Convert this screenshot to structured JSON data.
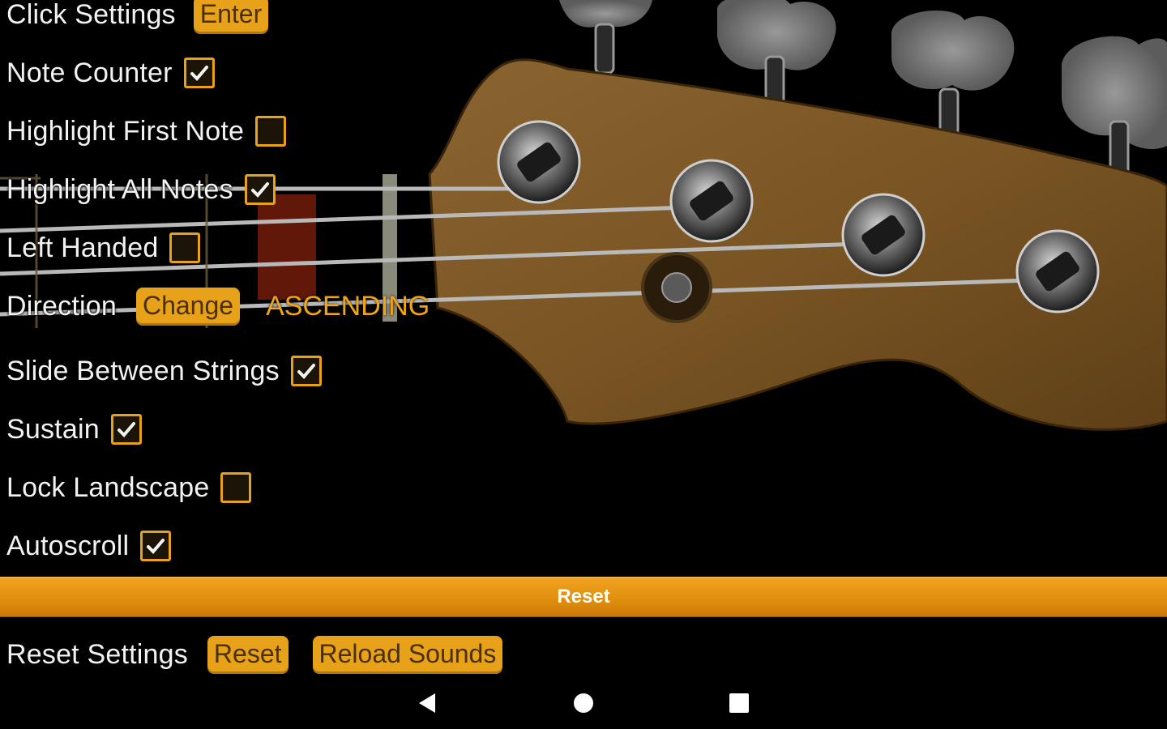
{
  "settings": {
    "click_settings": {
      "label": "Click Settings",
      "button": "Enter"
    },
    "note_counter": {
      "label": "Note Counter",
      "checked": true
    },
    "highlight_first_note": {
      "label": "Highlight First Note",
      "checked": false
    },
    "highlight_all_notes": {
      "label": "Highlight All Notes",
      "checked": true
    },
    "left_handed": {
      "label": "Left Handed",
      "checked": false
    },
    "direction": {
      "label": "Direction",
      "button": "Change",
      "value": "ASCENDING"
    },
    "slide_between_strings": {
      "label": "Slide Between Strings",
      "checked": true
    },
    "sustain": {
      "label": "Sustain",
      "checked": true
    },
    "lock_landscape": {
      "label": "Lock Landscape",
      "checked": false
    },
    "autoscroll": {
      "label": "Autoscroll",
      "checked": true
    }
  },
  "section": {
    "title": "Reset"
  },
  "reset_row": {
    "label": "Reset Settings",
    "reset_button": "Reset",
    "reload_button": "Reload Sounds"
  },
  "navbar": {
    "back_icon": "back-triangle-icon",
    "home_icon": "home-circle-icon",
    "recents_icon": "recents-square-icon"
  },
  "colors": {
    "accent": "#e8a21a",
    "background": "#000000",
    "bar": "#e08f0e",
    "text": "#f2f2f2"
  }
}
